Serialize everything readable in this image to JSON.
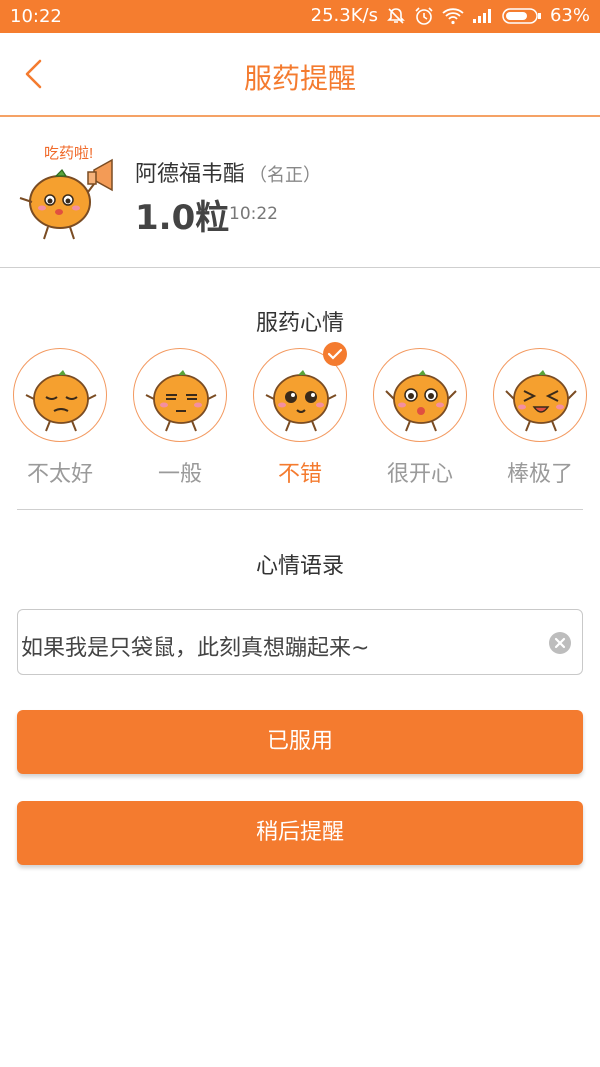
{
  "status_bar": {
    "time": "10:22",
    "network_speed": "25.3K/s",
    "battery_percent": "63%",
    "icons": [
      "mute-icon",
      "alarm-icon",
      "wifi-icon",
      "signal-icon",
      "battery-icon"
    ]
  },
  "header": {
    "back_icon": "back-icon",
    "title": "服药提醒"
  },
  "medicine": {
    "mascot_caption": "吃药啦!",
    "name": "阿德福韦酯",
    "brand": "（名正）",
    "dose": "1.0粒",
    "time": "10:22"
  },
  "mood": {
    "title": "服药心情",
    "options": [
      {
        "label": "不太好",
        "selected": false
      },
      {
        "label": "一般",
        "selected": false
      },
      {
        "label": "不错",
        "selected": true
      },
      {
        "label": "很开心",
        "selected": false
      },
      {
        "label": "棒极了",
        "selected": false
      }
    ]
  },
  "quote": {
    "title": "心情语录",
    "value": "如果我是只袋鼠，此刻真想蹦起来~"
  },
  "buttons": {
    "taken": "已服用",
    "remind_later": "稍后提醒"
  },
  "colors": {
    "accent": "#f47b2f",
    "status_bar": "#f57d2f"
  }
}
